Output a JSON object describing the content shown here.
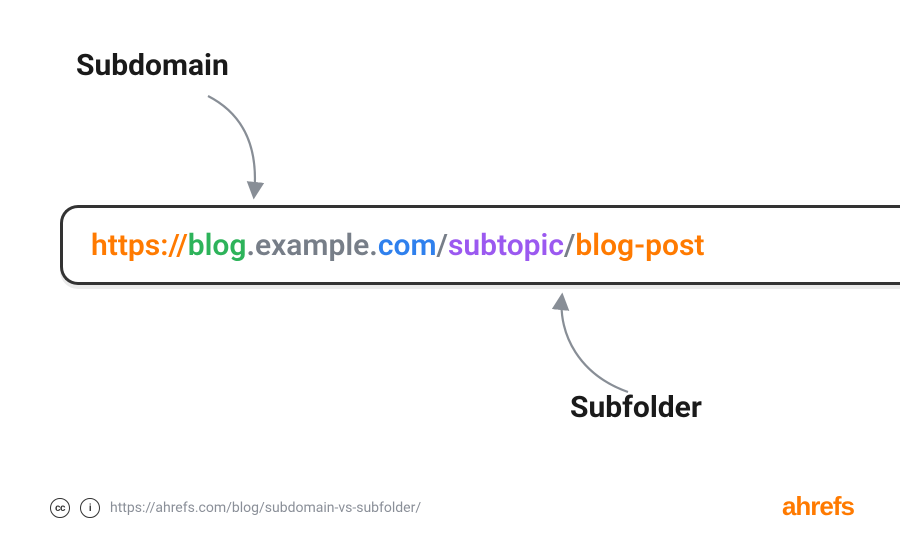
{
  "labels": {
    "subdomain": "Subdomain",
    "subfolder": "Subfolder"
  },
  "url": {
    "scheme": "https://",
    "subdomain": "blog",
    "dot1": ".",
    "domain": "example",
    "dot2": ".",
    "tld": "com",
    "slash1": "/",
    "subtopic": "subtopic",
    "slash2": "/",
    "post": "blog-post"
  },
  "footer": {
    "cc": "cc",
    "by": "i",
    "url": "https://ahrefs.com/blog/subdomain-vs-subfolder/"
  },
  "logo": "ahrefs",
  "colors": {
    "orange": "#ff7a00",
    "green": "#2db35a",
    "gray": "#777e88",
    "blue": "#2f80ed",
    "purple": "#9b59f0"
  }
}
